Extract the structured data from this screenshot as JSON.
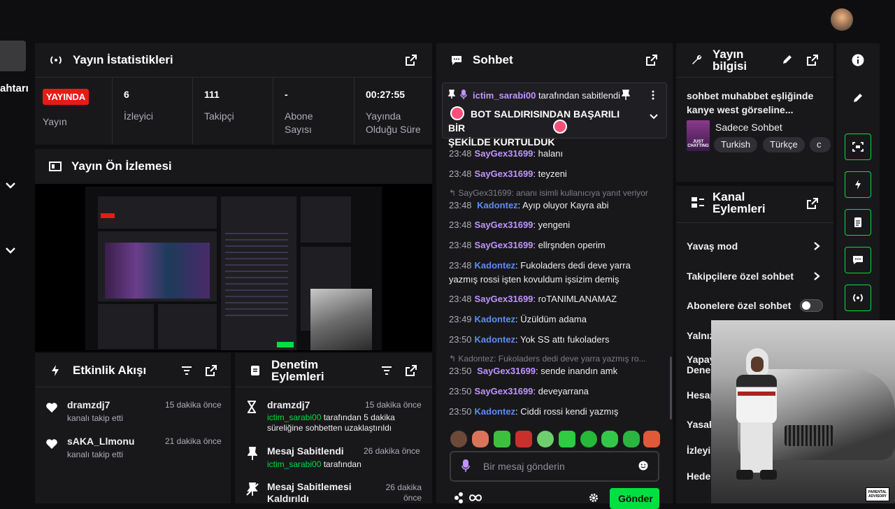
{
  "left_edge": {
    "cut_text": "ahtarı"
  },
  "stats": {
    "title": "Yayın İstatistikleri",
    "live_badge": "YAYINDA",
    "live_label": "Yayın",
    "viewers_value": "6",
    "viewers_label": "İzleyici",
    "followers_value": "111",
    "followers_label": "Takipçi",
    "subs_value": "-",
    "subs_label_1": "Abone",
    "subs_label_2": "Sayısı",
    "uptime_value": "00:27:55",
    "uptime_label_1": "Yayında",
    "uptime_label_2": "Olduğu Süre"
  },
  "preview": {
    "title": "Yayın Ön İzlemesi"
  },
  "activity": {
    "title": "Etkinlik Akışı",
    "items": [
      {
        "user": "dramzdj7",
        "time": "15 dakika önce",
        "desc": "kanalı takip etti"
      },
      {
        "user": "sAKA_Llmonu",
        "time": "21 dakika önce",
        "desc": "kanalı takip etti"
      }
    ]
  },
  "moderation": {
    "title_1": "Denetim",
    "title_2": "Eylemleri",
    "items": [
      {
        "user": "dramzdj7",
        "time": "15 dakika önce",
        "actor": "ictim_sarabi00",
        "desc_1": " tarafından 5 dakika",
        "desc_2": "süreliğine sohbetten uzaklaştırıldı"
      },
      {
        "title": "Mesaj Sabitlendi",
        "time": "26 dakika önce",
        "actor": "ictim_sarabi00",
        "desc_1": " tarafından"
      },
      {
        "title_1": "Mesaj Sabitlemesi",
        "title_2": "Kaldırıldı",
        "time_1": "26 dakika",
        "time_2": "önce"
      }
    ]
  },
  "chat": {
    "title": "Sohbet",
    "pinned_by": "ictim_sarabi00",
    "pinned_suffix": " tarafından sabitlendi",
    "pinned_text_1": "BOT SALDIRISINDAN BAŞARILI BİR",
    "pinned_text_2": "ŞEKİLDE KURTULDUK",
    "messages": [
      {
        "time": "23:48",
        "user": "SayGex31699",
        "color": "purple",
        "text": ": halanı"
      },
      {
        "time": "23:48",
        "user": "SayGex31699",
        "color": "purple",
        "text": ": teyzeni"
      },
      {
        "reply": "SayGex31699: ananı isimli kullanıcıya yanıt veriyor"
      },
      {
        "time": "23:48",
        "user": "Kadontez",
        "color": "blue",
        "text": ": Ayıp oluyor Kayra abi"
      },
      {
        "time": "23:48",
        "user": "SayGex31699",
        "color": "purple",
        "text": ": yengeni"
      },
      {
        "time": "23:48",
        "user": "SayGex31699",
        "color": "purple",
        "text": ": ellrşnden operim"
      },
      {
        "time": "23:48",
        "user": "Kadontez",
        "color": "blue",
        "text": ": Fukoladers dedi deve yarra",
        "text2": "yazmış rossi işten kovuldum işsizim demiş"
      },
      {
        "time": "23:48",
        "user": "SayGex31699",
        "color": "purple",
        "text": ": roTANIMLANAMAZ"
      },
      {
        "time": "23:49",
        "user": "Kadontez",
        "color": "blue",
        "text": ": Üzüldüm adama"
      },
      {
        "time": "23:50",
        "user": "Kadontez",
        "color": "blue",
        "text": ": Yok SS attı fukoladers"
      },
      {
        "reply": "Kadontez: Fukoladers dedi deve yarra yazmış ro..."
      },
      {
        "time": "23:50",
        "user": "SayGex31699",
        "color": "purple",
        "text": ": sende inandın amk"
      },
      {
        "time": "23:50",
        "user": "SayGex31699",
        "color": "purple",
        "text": ": deveyarrana"
      },
      {
        "time": "23:50",
        "user": "Kadontez",
        "color": "blue",
        "text": ": Ciddi rossi kendi yazmış"
      }
    ],
    "input_placeholder": "Bir mesaj gönderin",
    "send_label": "Gönder"
  },
  "stream_info": {
    "title_1": "Yayın",
    "title_2": "bilgisi",
    "desc_1": "sohbet muhabbet eşliğinde",
    "desc_2": "kanye west görseline...",
    "category": "Sadece Sohbet",
    "thumb_text": "JUST CHATTING",
    "tags": [
      "Turkish",
      "Türkçe",
      "c"
    ]
  },
  "channel_actions": {
    "title_1": "Kanal",
    "title_2": "Eylemleri",
    "slow_mode": "Yavaş mod",
    "followers_only": "Takipçilere özel sohbet",
    "subs_only": "Abonelere özel sohbet",
    "cut_1": "Yalnız",
    "cut_2a": "Yapay",
    "cut_2b": "Dene",
    "cut_3": "Hesap",
    "cut_4": "Yasak",
    "cut_5": "İzleyi",
    "cut_6": "Hede"
  },
  "overlay": {
    "advisory_1": "PARENTAL",
    "advisory_2": "ADVISORY"
  },
  "colors": {
    "accent": "#00e040",
    "live": "#e91916",
    "purple": "#bf94ff",
    "blue": "#5c8df6",
    "panel": "#18181b"
  }
}
